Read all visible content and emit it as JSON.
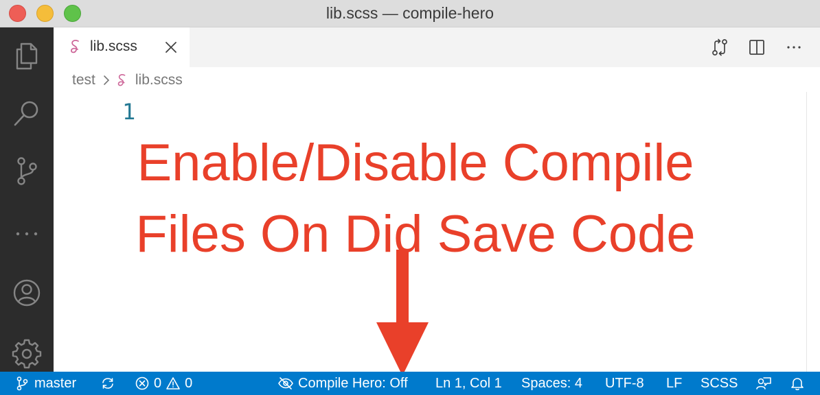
{
  "window": {
    "title": "lib.scss — compile-hero"
  },
  "activity_bar": {
    "icons": [
      "files-icon",
      "search-icon",
      "source-control-icon",
      "more-icon",
      "accounts-icon",
      "settings-gear-icon"
    ]
  },
  "tab": {
    "label": "lib.scss",
    "icon": "sass-file-icon",
    "close_icon": "close-icon"
  },
  "editor_actions": {
    "icons": [
      "compare-changes-icon",
      "split-editor-icon",
      "more-actions-icon"
    ]
  },
  "breadcrumb": {
    "folder": "test",
    "file": "lib.scss"
  },
  "editor": {
    "line_number": "1"
  },
  "annotation": {
    "line1": "Enable/Disable Compile",
    "line2": "Files On Did Save Code",
    "color": "#e9402a"
  },
  "status_bar": {
    "branch": "master",
    "errors": "0",
    "warnings": "0",
    "compile_hero": "Compile Hero: Off",
    "position": "Ln 1, Col 1",
    "spaces": "Spaces: 4",
    "encoding": "UTF-8",
    "eol": "LF",
    "language": "SCSS",
    "color": "#007acc"
  }
}
